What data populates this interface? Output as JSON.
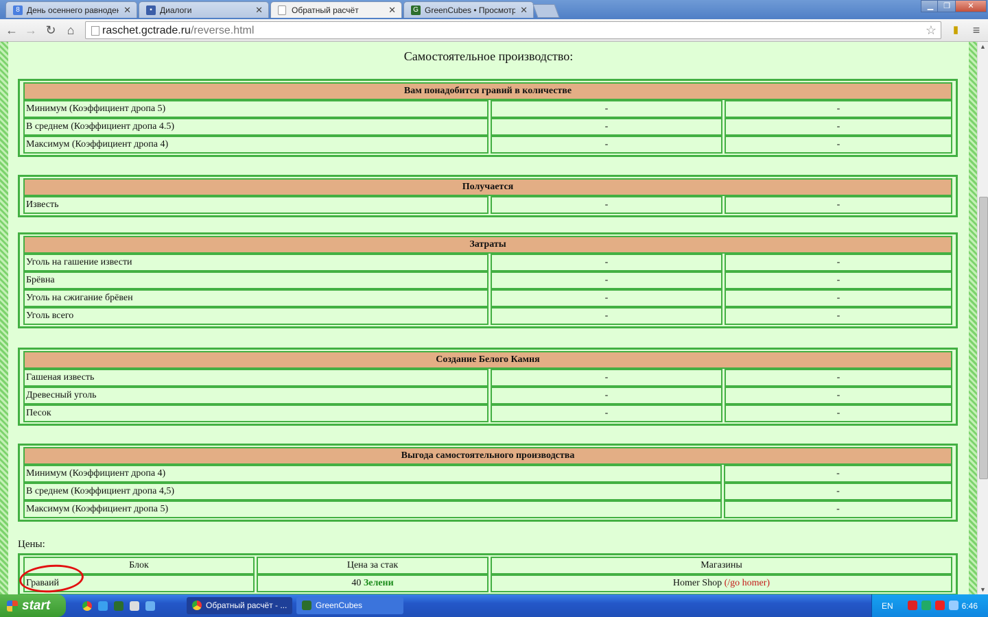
{
  "browser": {
    "tabs": [
      {
        "label": "День осеннего равноденст",
        "icon": "google-icon",
        "color": "#4a7fe0"
      },
      {
        "label": "Диалоги",
        "icon": "chat-icon",
        "color": "#3b5ea8"
      },
      {
        "label": "Обратный расчёт",
        "icon": "page-icon",
        "color": "#ffffff"
      },
      {
        "label": "GreenCubes • Просмотр фор",
        "icon": "greencubes-icon",
        "color": "#2c6e2c"
      }
    ],
    "url_host": "raschet.gctrade.ru",
    "url_path": "/reverse.html"
  },
  "page": {
    "heading": "Самостоятельное производство:",
    "gravel": {
      "header": "Вам понадобится гравий в количестве",
      "rows": [
        {
          "label": "Минимум (Коэффициент дропа 5)",
          "v1": "-",
          "v2": "-"
        },
        {
          "label": "В среднем (Коэффициент дропа 4.5)",
          "v1": "-",
          "v2": "-"
        },
        {
          "label": "Максимум (Коэффициент дропа 4)",
          "v1": "-",
          "v2": "-"
        }
      ]
    },
    "result": {
      "header": "Получается",
      "rows": [
        {
          "label": "Известь",
          "v1": "-",
          "v2": "-"
        }
      ]
    },
    "costs": {
      "header": "Затраты",
      "rows": [
        {
          "label": "Уголь на гашение извести",
          "v1": "-",
          "v2": "-"
        },
        {
          "label": "Брёвна",
          "v1": "-",
          "v2": "-"
        },
        {
          "label": "Уголь на сжигание брёвен",
          "v1": "-",
          "v2": "-"
        },
        {
          "label": "Уголь всего",
          "v1": "-",
          "v2": "-"
        }
      ]
    },
    "whitestone": {
      "header": "Создание Белого Камня",
      "rows": [
        {
          "label": "Гашеная известь",
          "v1": "-",
          "v2": "-"
        },
        {
          "label": "Древесный уголь",
          "v1": "-",
          "v2": "-"
        },
        {
          "label": "Песок",
          "v1": "-",
          "v2": "-"
        }
      ]
    },
    "profit": {
      "header": "Выгода самостоятельного производства",
      "rows": [
        {
          "label": "Минимум (Коэффициент дропа 4)",
          "v1": "-"
        },
        {
          "label": "В среднем (Коэффициент дропа 4,5)",
          "v1": "-"
        },
        {
          "label": "Максимум (Коэффициент дропа 5)",
          "v1": "-"
        }
      ]
    },
    "prices": {
      "label": "Цены:",
      "columns": [
        "Блок",
        "Цена за стак",
        "Магазины"
      ],
      "row": {
        "block": "Граваий",
        "price_amount": "40",
        "price_currency": "Зелени",
        "shop": "Homer Shop",
        "shop_cmd": "(/go homer)"
      }
    }
  },
  "taskbar": {
    "start": "start",
    "tasks": [
      "Обратный расчёт - ...",
      "GreenCubes"
    ],
    "language": "EN",
    "clock": "6:46"
  }
}
